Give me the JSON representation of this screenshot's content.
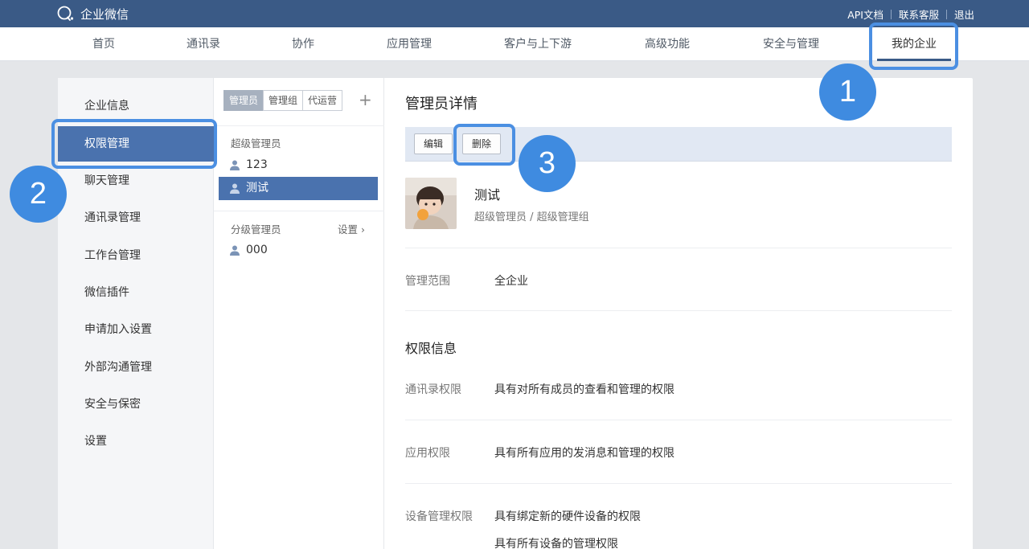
{
  "app": {
    "brand": "企业微信"
  },
  "toplinks": [
    "API文档",
    "联系客服",
    "退出"
  ],
  "nav": {
    "items": [
      "首页",
      "通讯录",
      "协作",
      "应用管理",
      "客户与上下游",
      "高级功能",
      "安全与管理",
      "我的企业"
    ],
    "active_index": 7
  },
  "sidebar": {
    "items": [
      "企业信息",
      "权限管理",
      "聊天管理",
      "通讯录管理",
      "工作台管理",
      "微信插件",
      "申请加入设置",
      "外部沟通管理",
      "安全与保密",
      "设置"
    ],
    "active_index": 1
  },
  "middle": {
    "tabs": [
      "管理员",
      "管理组",
      "代运营"
    ],
    "active_tab": 0,
    "add": "+",
    "super_admins_label": "超级管理员",
    "super_admins": [
      "123",
      "测试"
    ],
    "selected_admin": "测试",
    "sub_admins_label": "分级管理员",
    "sub_admins_settings": "设置 ›",
    "sub_admins": [
      "000"
    ]
  },
  "detail": {
    "title": "管理员详情",
    "edit_button": "编辑",
    "delete_button": "删除",
    "name": "测试",
    "role": "超级管理员 / 超级管理组",
    "scope_label": "管理范围",
    "scope_value": "全企业",
    "permissions_title": "权限信息",
    "contacts_perm_label": "通讯录权限",
    "contacts_perm_value": "具有对所有成员的查看和管理的权限",
    "app_perm_label": "应用权限",
    "app_perm_value": "具有所有应用的发消息和管理的权限",
    "device_perm_label": "设备管理权限",
    "device_perm_value_1": "具有绑定新的硬件设备的权限",
    "device_perm_value_2": "具有所有设备的管理权限"
  },
  "callouts": [
    "1",
    "2",
    "3"
  ],
  "colors": {
    "header": "#3a5a86",
    "active": "#4a72ae",
    "callout": "#3f8be0"
  }
}
